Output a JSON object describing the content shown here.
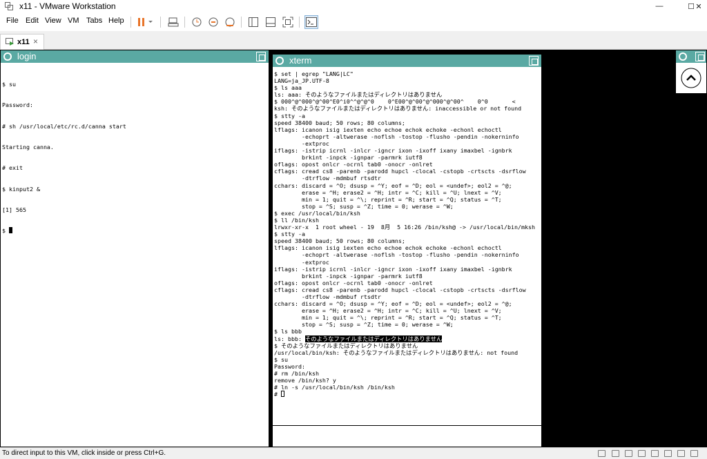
{
  "window": {
    "title": "x11 - VMware Workstation",
    "controls": {
      "minimize": "—",
      "maximize": "☐",
      "close": "✕"
    }
  },
  "menu": {
    "items": [
      "File",
      "Edit",
      "View",
      "VM",
      "Tabs",
      "Help"
    ],
    "accent_color": "#e8752a"
  },
  "tabs": [
    {
      "label": "x11",
      "close": "×"
    }
  ],
  "vm": {
    "login": {
      "title": "login",
      "lines": [
        "$ su",
        "Password:",
        "# sh /usr/local/etc/rc.d/canna start",
        "Starting canna.",
        "# exit",
        "$ kinput2 &",
        "[1] 565",
        "$ "
      ]
    },
    "xterm": {
      "title": "xterm",
      "lines": [
        "$ set | egrep \"LANG|LC\"",
        "LANG=ja_JP.UTF-8",
        "$ ls aaa",
        "ls: aaa: そのようなファイルまたはディレクトリはありません",
        "$ 000^@^000^@^00^E0^i0^^@^@^0    0^E00^@^00^@^000^@^00^    0^0       <",
        "ksh: そのようなファイルまたはディレクトリはありません: inaccessible or not found",
        "$ stty -a",
        "speed 38400 baud; 50 rows; 80 columns;",
        "lflags: icanon isig iexten echo echoe echok echoke -echonl echoctl",
        "        -echoprt -altwerase -noflsh -tostop -flusho -pendin -nokerninfo",
        "        -extproc",
        "iflags: -istrip icrnl -inlcr -igncr ixon -ixoff ixany imaxbel -ignbrk",
        "        brkint -inpck -ignpar -parmrk iutf8",
        "oflags: opost onlcr -ocrnl tab0 -onocr -onlret",
        "cflags: cread cs8 -parenb -parodd hupcl -clocal -cstopb -crtscts -dsrflow",
        "        -dtrflow -mdmbuf rtsdtr",
        "cchars: discard = ^O; dsusp = ^Y; eof = ^D; eol = <undef>; eol2 = ^@;",
        "        erase = ^H; erase2 = ^H; intr = ^C; kill = ^U; lnext = ^V;",
        "        min = 1; quit = ^\\; reprint = ^R; start = ^Q; status = ^T;",
        "        stop = ^S; susp = ^Z; time = 0; werase = ^W;",
        "$ exec /usr/local/bin/ksh",
        "$ ll /bin/ksh",
        "lrwxr-xr-x  1 root wheel - 19  8月  5 16:26 /bin/ksh@ -> /usr/local/bin/mksh",
        "$ stty -a",
        "speed 38400 baud; 50 rows; 80 columns;",
        "lflags: icanon isig iexten echo echoe echok echoke -echonl echoctl",
        "        -echoprt -altwerase -noflsh -tostop -flusho -pendin -nokerninfo",
        "        -extproc",
        "iflags: -istrip icrnl -inlcr -igncr ixon -ixoff ixany imaxbel -ignbrk",
        "        brkint -inpck -ignpar -parmrk iutf8",
        "oflags: opost onlcr -ocrnl tab0 -onocr -onlret",
        "cflags: cread cs8 -parenb -parodd hupcl -clocal -cstopb -crtscts -dsrflow",
        "        -dtrflow -mdmbuf rtsdtr",
        "cchars: discard = ^O; dsusp = ^Y; eof = ^D; eol = <undef>; eol2 = ^@;",
        "        erase = ^H; erase2 = ^H; intr = ^C; kill = ^U; lnext = ^V;",
        "        min = 1; quit = ^\\; reprint = ^R; start = ^Q; status = ^T;",
        "        stop = ^S; susp = ^Z; time = 0; werase = ^W;",
        "$ ls bbb"
      ],
      "highlight_prefix": "ls: bbb: ",
      "highlight_text": "そのようなファイルまたはディレクトリはありません",
      "lines_after": [
        "$ そのようなファイルまたはディレクトリはありません",
        "/usr/local/bin/ksh: そのようなファイルまたはディレクトリはありません: not found",
        "$ su",
        "Password:",
        "# rm /bin/ksh",
        "remove /bin/ksh? y",
        "# ln -s /usr/local/bin/ksh /bin/ksh",
        "# "
      ]
    },
    "titlebar_color": "#5aa9a3"
  },
  "status": {
    "text": "To direct input to this VM, click inside or press Ctrl+G."
  }
}
